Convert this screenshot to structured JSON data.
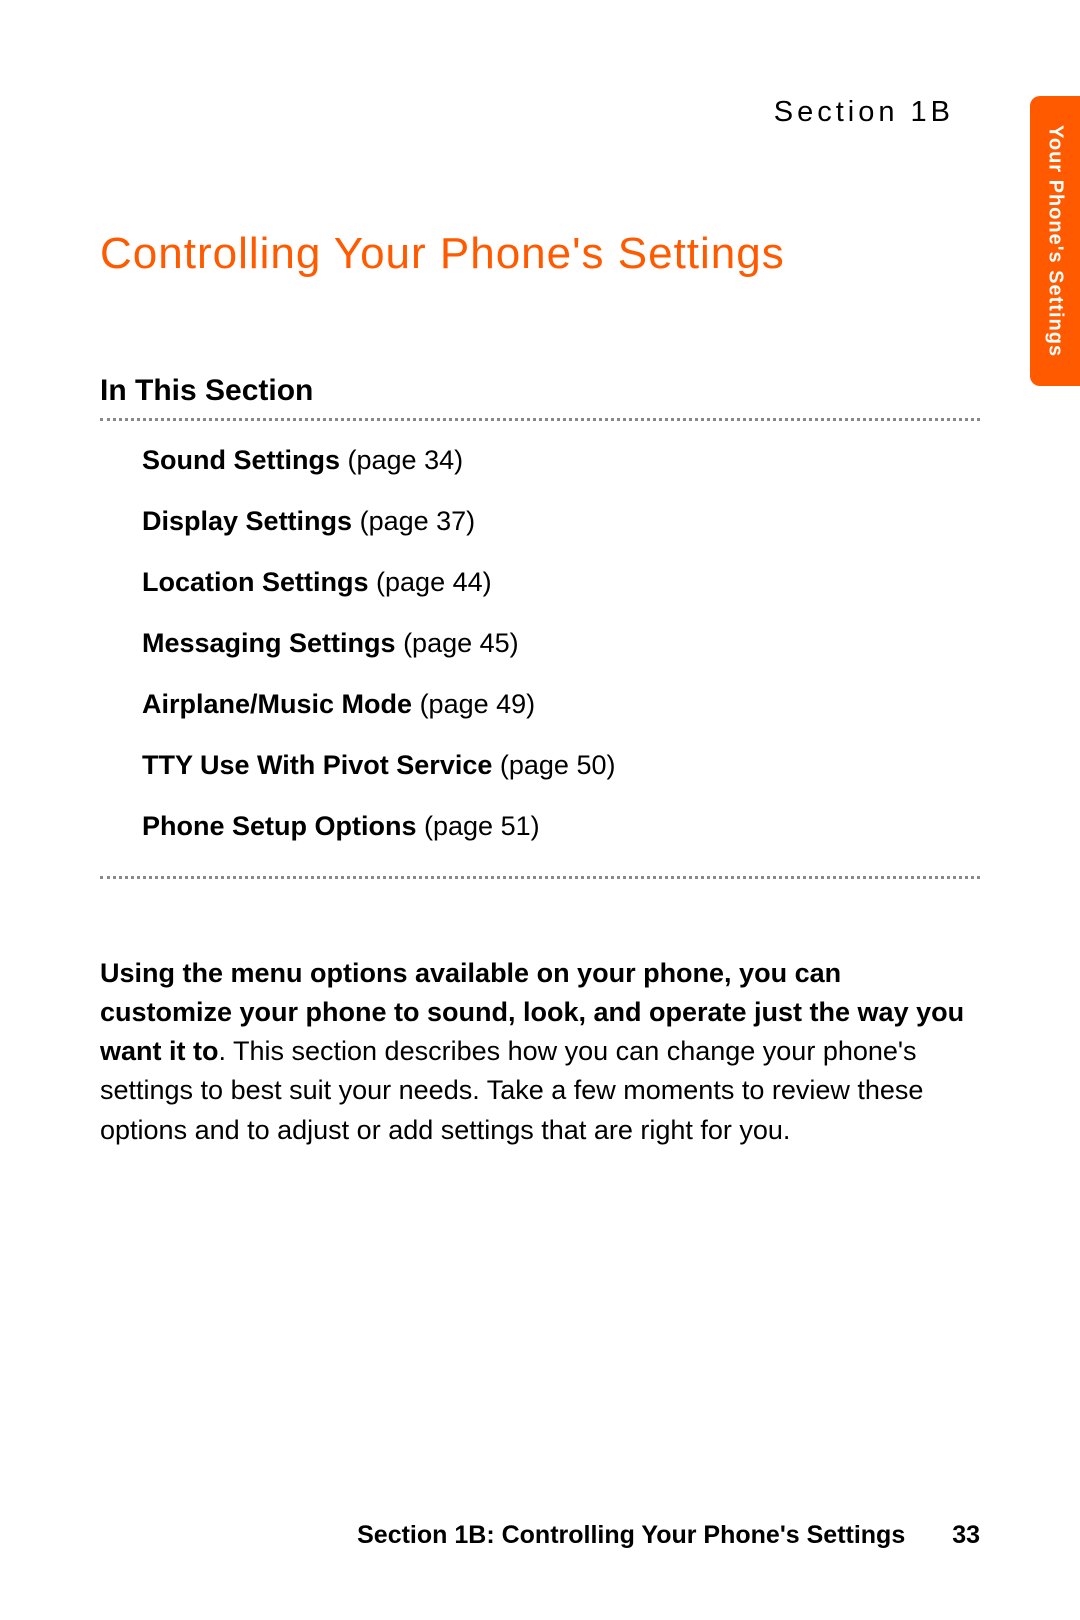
{
  "header": {
    "section_label": "Section 1B",
    "tab_label": "Your Phone's Settings"
  },
  "title": "Controlling Your Phone's Settings",
  "subtitle": "In This Section",
  "toc": [
    {
      "title": "Sound Settings",
      "page": "(page 34)"
    },
    {
      "title": "Display Settings",
      "page": "(page 37)"
    },
    {
      "title": "Location Settings",
      "page": "(page 44)"
    },
    {
      "title": "Messaging Settings",
      "page": "(page 45)"
    },
    {
      "title": "Airplane/Music Mode",
      "page": "(page 49)"
    },
    {
      "title": "TTY Use With Pivot Service",
      "page": "(page 50)"
    },
    {
      "title": "Phone Setup Options",
      "page": "(page 51)"
    }
  ],
  "body": {
    "bold_part": "Using the menu options available on your phone, you can customize your phone to sound, look, and operate just the way you want it to",
    "rest": ". This section describes how you can change your phone's settings to best suit your needs. Take a few moments to review these options and to adjust or add settings that are right for you."
  },
  "footer": {
    "title": "Section 1B: Controlling Your Phone's Settings",
    "page": "33"
  }
}
